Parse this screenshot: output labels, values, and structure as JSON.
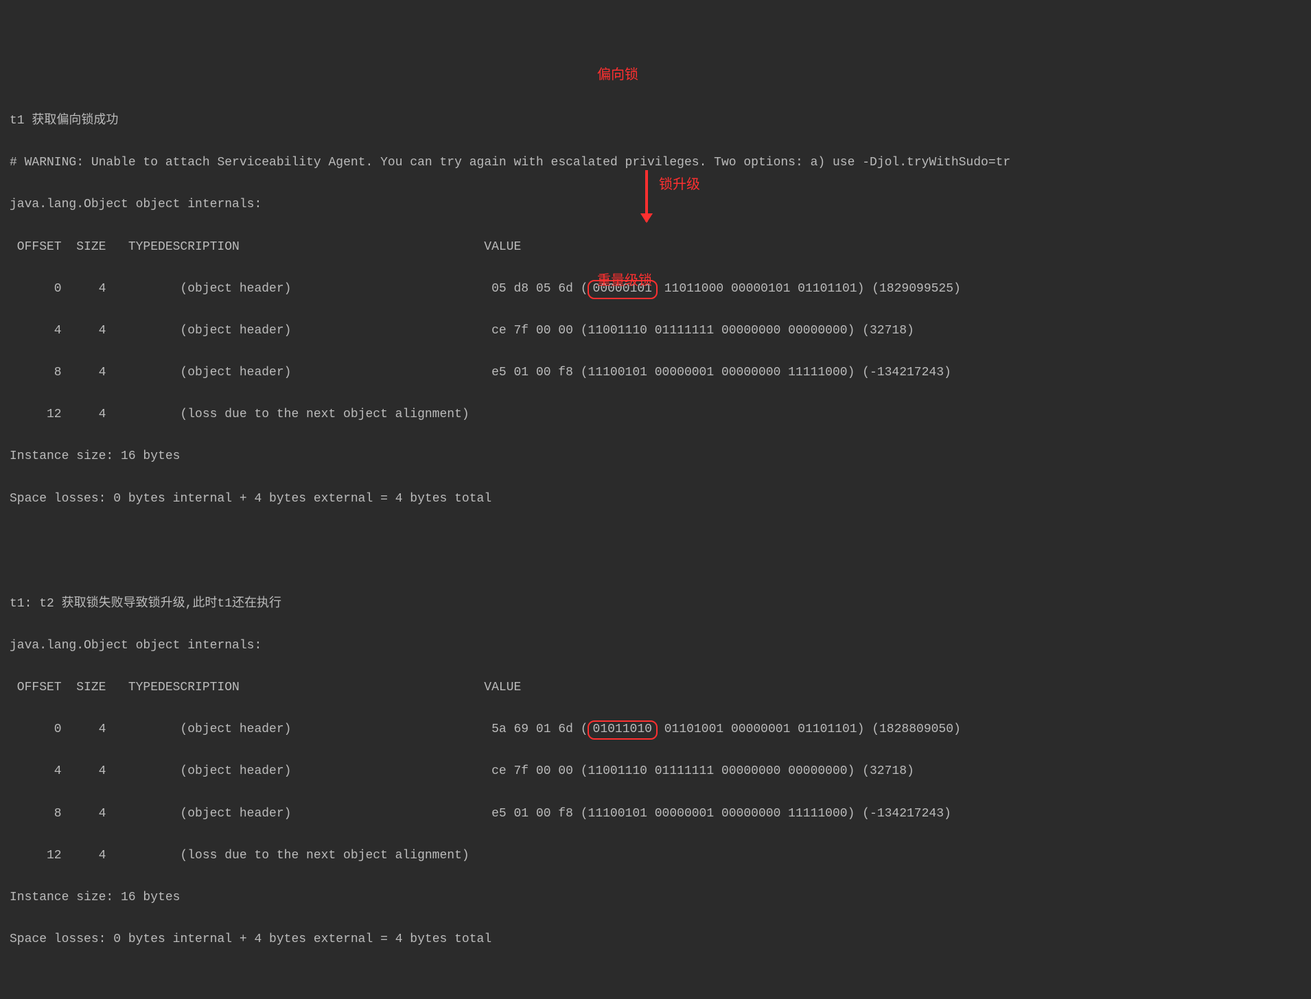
{
  "block1": {
    "title": "t1 获取偏向锁成功",
    "warning": "# WARNING: Unable to attach Serviceability Agent. You can try again with escalated privileges. Two options: a) use -Djol.tryWithSudo=tr",
    "internals": "java.lang.Object object internals:",
    "hdr": {
      "offset": " OFFSET",
      "size": "  SIZE",
      "type": " TYPE",
      "desc": "DESCRIPTION",
      "value": "VALUE"
    },
    "rows": [
      {
        "offset": "0",
        "size": "4",
        "type": "",
        "desc": "(object header)",
        "hex": "05 d8 05 6d ",
        "open": "(",
        "hl": "00000101",
        "rest": " 11011000 00000101 01101101) (1829099525)"
      },
      {
        "offset": "4",
        "size": "4",
        "type": "",
        "desc": "(object header)",
        "hex": "ce 7f 00 00 ",
        "rest_full": "(11001110 01111111 00000000 00000000) (32718)"
      },
      {
        "offset": "8",
        "size": "4",
        "type": "",
        "desc": "(object header)",
        "hex": "e5 01 00 f8 ",
        "rest_full": "(11100101 00000001 00000000 11111000) (-134217243)"
      },
      {
        "offset": "12",
        "size": "4",
        "type": "",
        "desc": "(loss due to the next object alignment)",
        "hex": "",
        "rest_full": ""
      }
    ],
    "instance": "Instance size: 16 bytes",
    "losses": "Space losses: 0 bytes internal + 4 bytes external = 4 bytes total"
  },
  "block2": {
    "title": "t1: t2 获取锁失败导致锁升级,此时t1还在执行",
    "internals": "java.lang.Object object internals:",
    "hdr": {
      "offset": " OFFSET",
      "size": "  SIZE",
      "type": " TYPE",
      "desc": "DESCRIPTION",
      "value": "VALUE"
    },
    "rows": [
      {
        "offset": "0",
        "size": "4",
        "type": "",
        "desc": "(object header)",
        "hex": "5a 69 01 6d ",
        "open": "(",
        "hl": "01011010",
        "rest": " 01101001 00000001 01101101) (1828809050)"
      },
      {
        "offset": "4",
        "size": "4",
        "type": "",
        "desc": "(object header)",
        "hex": "ce 7f 00 00 ",
        "rest_full": "(11001110 01111111 00000000 00000000) (32718)"
      },
      {
        "offset": "8",
        "size": "4",
        "type": "",
        "desc": "(object header)",
        "hex": "e5 01 00 f8 ",
        "rest_full": "(11100101 00000001 00000000 11111000) (-134217243)"
      },
      {
        "offset": "12",
        "size": "4",
        "type": "",
        "desc": "(loss due to the next object alignment)",
        "hex": "",
        "rest_full": ""
      }
    ],
    "instance": "Instance size: 16 bytes",
    "losses": "Space losses: 0 bytes internal + 4 bytes external = 4 bytes total"
  },
  "annotations": {
    "biased_lock": "偏向锁",
    "lock_upgrade": "锁升级",
    "heavy_lock": "重量级锁"
  }
}
